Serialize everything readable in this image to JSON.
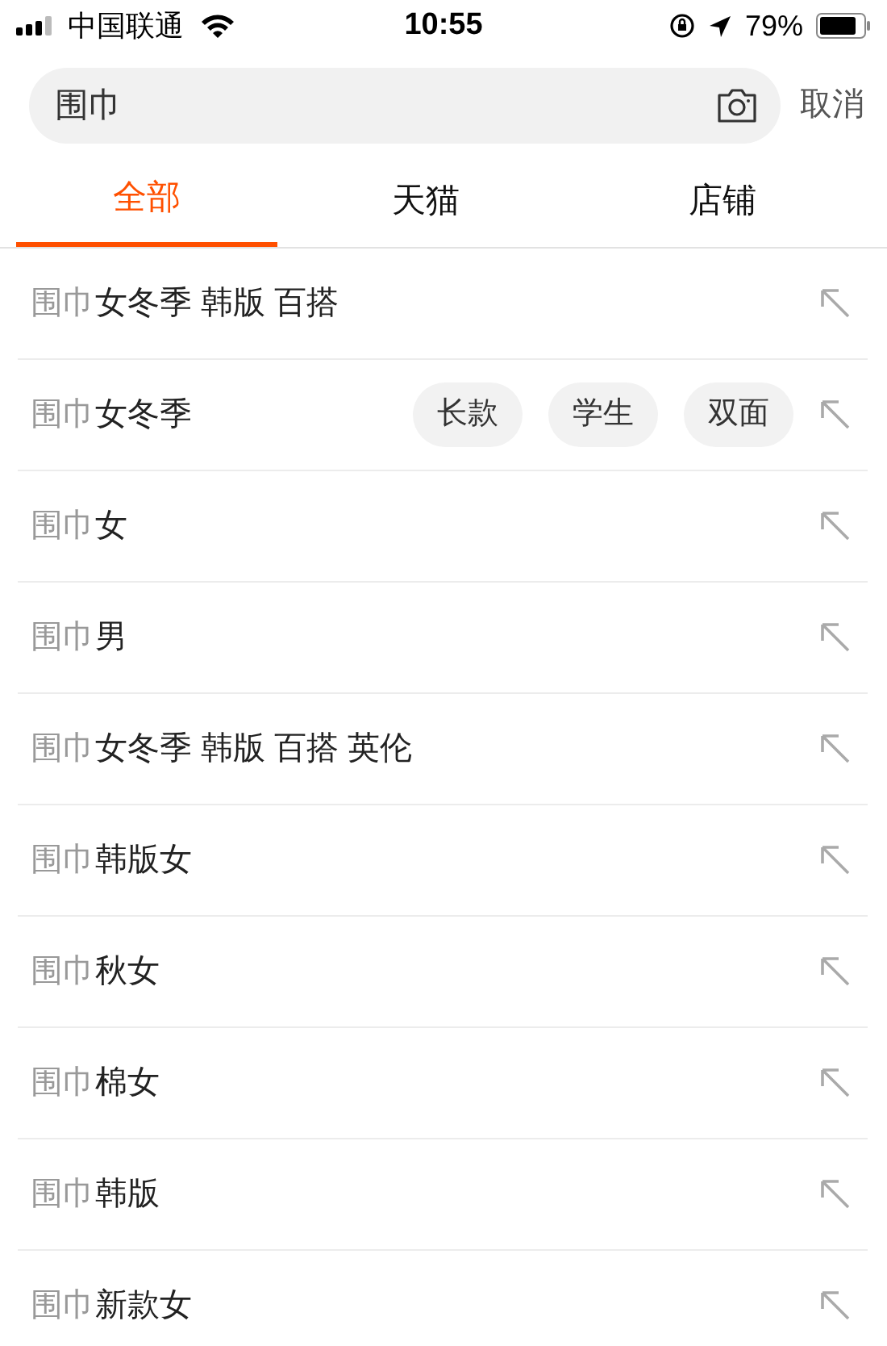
{
  "status_bar": {
    "carrier": "中国联通",
    "time": "10:55",
    "battery": "79%"
  },
  "search": {
    "value": "围巾",
    "cancel": "取消"
  },
  "tabs": [
    {
      "label": "全部",
      "selected": true
    },
    {
      "label": "天猫",
      "selected": false
    },
    {
      "label": "店铺",
      "selected": false
    }
  ],
  "suggestions": [
    {
      "prefix": "围巾",
      "rest": "女冬季 韩版 百搭"
    },
    {
      "prefix": "围巾",
      "rest": "女冬季",
      "tags": [
        "长款",
        "学生",
        "双面"
      ]
    },
    {
      "prefix": "围巾",
      "rest": "女"
    },
    {
      "prefix": "围巾",
      "rest": "男"
    },
    {
      "prefix": "围巾",
      "rest": "女冬季 韩版 百搭 英伦"
    },
    {
      "prefix": "围巾",
      "rest": "韩版女"
    },
    {
      "prefix": "围巾",
      "rest": "秋女"
    },
    {
      "prefix": "围巾",
      "rest": "棉女"
    },
    {
      "prefix": "围巾",
      "rest": "韩版"
    },
    {
      "prefix": "围巾",
      "rest": "新款女"
    }
  ]
}
